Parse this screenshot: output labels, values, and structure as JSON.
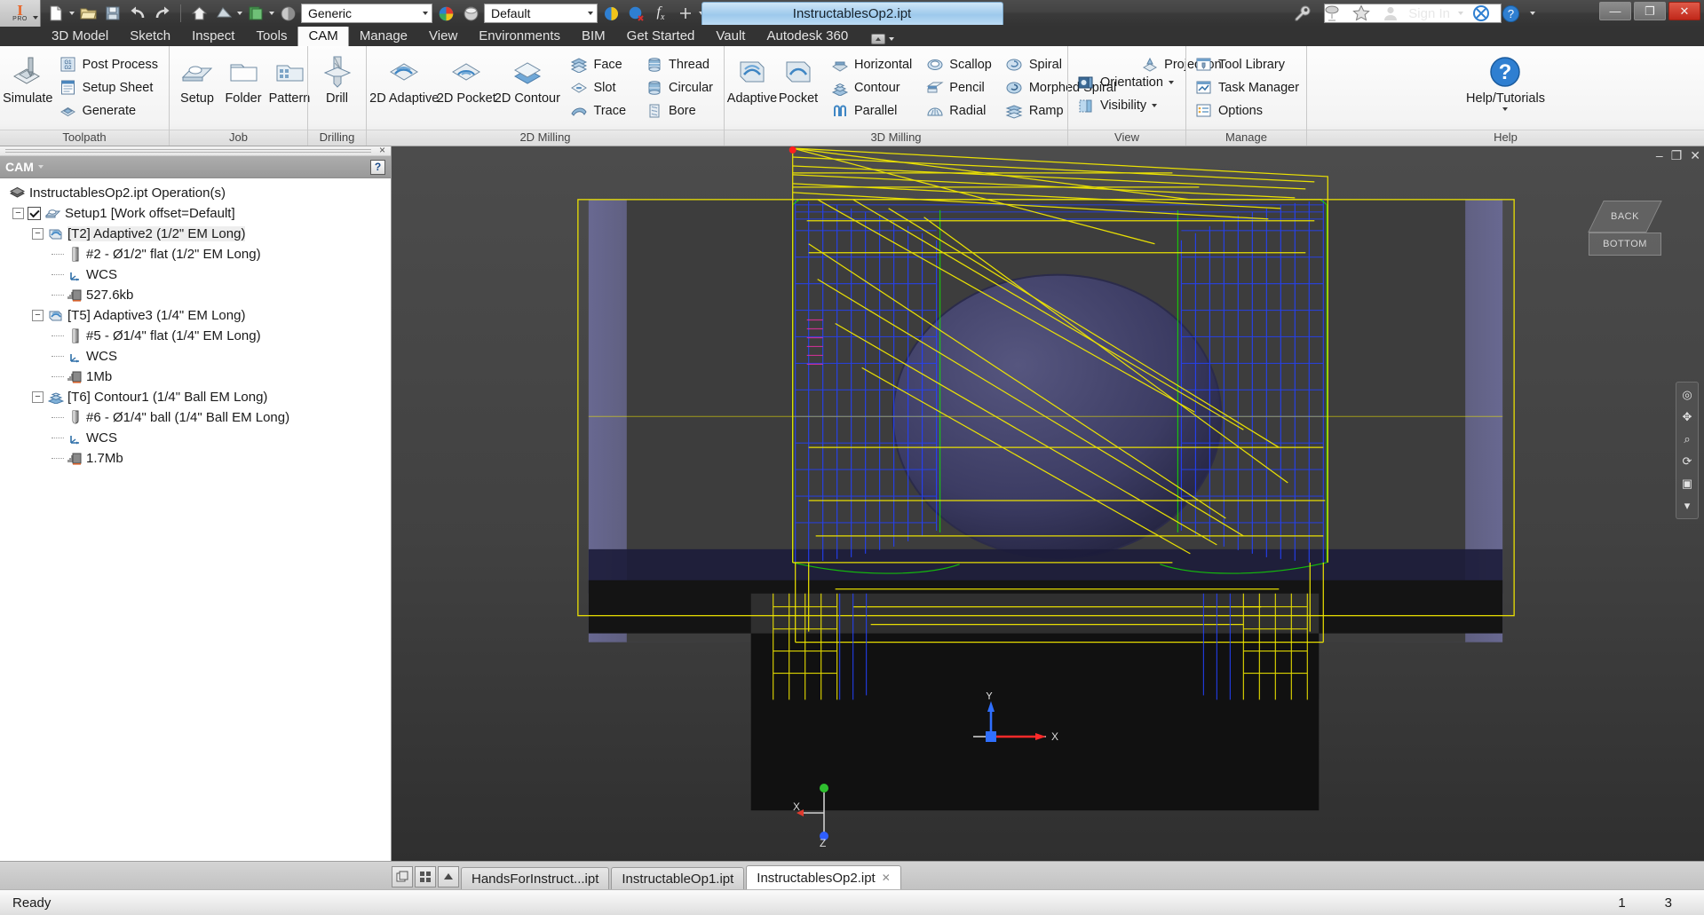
{
  "titlebar": {
    "app_name": "PRO",
    "document_title": "InstructablesOp2.ipt",
    "material_combo": "Generic",
    "appearance_combo": "Default",
    "search_placeholder": "",
    "search_value": "",
    "signin_label": "Sign In",
    "quick_access": [
      {
        "name": "new-file-icon",
        "label": "New"
      },
      {
        "name": "open-file-icon",
        "label": "Open"
      },
      {
        "name": "save-icon",
        "label": "Save"
      },
      {
        "name": "undo-icon",
        "label": "Undo"
      },
      {
        "name": "redo-icon",
        "label": "Redo"
      },
      {
        "name": "home-icon",
        "label": "Home"
      },
      {
        "name": "return-icon",
        "label": "Return"
      },
      {
        "name": "parameters-icon",
        "label": "Parameters"
      },
      {
        "name": "material-icon",
        "label": "Material"
      },
      {
        "name": "appearance-icon",
        "label": "Appearance"
      },
      {
        "name": "update-icon",
        "label": "Update"
      },
      {
        "name": "fx-icon",
        "label": "fx"
      },
      {
        "name": "plus-icon",
        "label": "Add"
      }
    ],
    "right_icons": [
      {
        "name": "wrench-icon",
        "label": "Help Options"
      },
      {
        "name": "satellite-icon",
        "label": "Autodesk 360"
      },
      {
        "name": "star-icon",
        "label": "Favorites"
      },
      {
        "name": "user-icon",
        "label": "Account"
      }
    ],
    "window_buttons": [
      {
        "name": "minimize-button",
        "glyph": "—"
      },
      {
        "name": "restore-button",
        "glyph": "❐"
      },
      {
        "name": "close-button",
        "glyph": "✕"
      }
    ]
  },
  "ribbon": {
    "tabs": [
      {
        "label": "3D Model",
        "active": false
      },
      {
        "label": "Sketch",
        "active": false
      },
      {
        "label": "Inspect",
        "active": false
      },
      {
        "label": "Tools",
        "active": false
      },
      {
        "label": "CAM",
        "active": true
      },
      {
        "label": "Manage",
        "active": false
      },
      {
        "label": "View",
        "active": false
      },
      {
        "label": "Environments",
        "active": false
      },
      {
        "label": "BIM",
        "active": false
      },
      {
        "label": "Get Started",
        "active": false
      },
      {
        "label": "Vault",
        "active": false
      },
      {
        "label": "Autodesk 360",
        "active": false
      }
    ],
    "panels": [
      {
        "title": "Toolpath",
        "big_buttons": [
          {
            "label": "Simulate",
            "icon": "simulate-icon"
          }
        ],
        "small_buttons": [
          {
            "label": "Post Process",
            "icon": "post-process-icon"
          },
          {
            "label": "Setup Sheet",
            "icon": "setup-sheet-icon"
          },
          {
            "label": "Generate",
            "icon": "generate-icon"
          }
        ]
      },
      {
        "title": "Job",
        "big_buttons": [
          {
            "label": "Setup",
            "icon": "setup-icon"
          },
          {
            "label": "Folder",
            "icon": "folder-icon"
          },
          {
            "label": "Pattern",
            "icon": "pattern-icon"
          }
        ],
        "small_buttons": []
      },
      {
        "title": "Drilling",
        "big_buttons": [
          {
            "label": "Drill",
            "icon": "drill-icon"
          }
        ],
        "small_buttons": []
      },
      {
        "title": "2D Milling",
        "big_buttons": [
          {
            "label": "2D Adaptive",
            "icon": "2d-adaptive-icon"
          },
          {
            "label": "2D Pocket",
            "icon": "2d-pocket-icon"
          },
          {
            "label": "2D Contour",
            "icon": "2d-contour-icon"
          }
        ],
        "small_col_a": [
          {
            "label": "Face",
            "icon": "face-icon"
          },
          {
            "label": "Slot",
            "icon": "slot-icon"
          },
          {
            "label": "Trace",
            "icon": "trace-icon"
          }
        ],
        "small_col_b": [
          {
            "label": "Thread",
            "icon": "thread-icon"
          },
          {
            "label": "Circular",
            "icon": "circular-icon"
          },
          {
            "label": "Bore",
            "icon": "bore-icon"
          }
        ]
      },
      {
        "title": "3D Milling",
        "big_buttons": [
          {
            "label": "Adaptive",
            "icon": "adaptive-icon"
          },
          {
            "label": "Pocket",
            "icon": "pocket-icon"
          }
        ],
        "small_col_a": [
          {
            "label": "Horizontal",
            "icon": "horizontal-icon"
          },
          {
            "label": "Contour",
            "icon": "contour-icon"
          },
          {
            "label": "Parallel",
            "icon": "parallel-icon"
          }
        ],
        "small_col_b": [
          {
            "label": "Scallop",
            "icon": "scallop-icon"
          },
          {
            "label": "Pencil",
            "icon": "pencil-icon"
          },
          {
            "label": "Radial",
            "icon": "radial-icon"
          }
        ],
        "small_col_c": [
          {
            "label": "Spiral",
            "icon": "spiral-icon"
          },
          {
            "label": "Morphed Spiral",
            "icon": "morphed-spiral-icon"
          },
          {
            "label": "Ramp",
            "icon": "ramp-icon"
          }
        ],
        "small_col_d": [
          {
            "label": "Projection",
            "icon": "projection-icon"
          }
        ]
      },
      {
        "title": "View",
        "small_buttons": [
          {
            "label": "Orientation",
            "icon": "orientation-icon",
            "dropdown": true
          },
          {
            "label": "Visibility",
            "icon": "visibility-icon",
            "dropdown": true
          }
        ]
      },
      {
        "title": "Manage",
        "small_buttons": [
          {
            "label": "Tool Library",
            "icon": "tool-library-icon"
          },
          {
            "label": "Task Manager",
            "icon": "task-manager-icon"
          },
          {
            "label": "Options",
            "icon": "options-icon"
          }
        ]
      },
      {
        "title": "Help",
        "big_buttons": [
          {
            "label": "Help/Tutorials",
            "icon": "help-icon"
          }
        ],
        "small_buttons": []
      }
    ]
  },
  "browser": {
    "header_label": "CAM",
    "help_glyph": "?",
    "tree": [
      {
        "level": 0,
        "label": "InstructablesOp2.ipt Operation(s)",
        "icon": "document-icon",
        "expander": null,
        "checkbox": false,
        "selected": false
      },
      {
        "level": 1,
        "label": "Setup1 [Work offset=Default]",
        "icon": "setup-icon",
        "expander": "minus",
        "checkbox": true,
        "selected": false
      },
      {
        "level": 2,
        "label": "[T2] Adaptive2 (1/2\" EM Long)",
        "icon": "adaptive-op-icon",
        "expander": "minus",
        "checkbox": false,
        "selected": true
      },
      {
        "level": 3,
        "label": "#2 - Ø1/2\" flat (1/2\" EM Long)",
        "icon": "flat-tool-icon",
        "expander": null,
        "checkbox": false,
        "selected": false
      },
      {
        "level": 3,
        "label": "WCS",
        "icon": "wcs-icon",
        "expander": null,
        "checkbox": false,
        "selected": false
      },
      {
        "level": 3,
        "label": "527.6kb",
        "icon": "toolpath-data-icon",
        "expander": null,
        "checkbox": false,
        "selected": false
      },
      {
        "level": 2,
        "label": "[T5] Adaptive3 (1/4\" EM Long)",
        "icon": "adaptive-op-icon",
        "expander": "minus",
        "checkbox": false,
        "selected": false
      },
      {
        "level": 3,
        "label": "#5 - Ø1/4\" flat (1/4\" EM Long)",
        "icon": "flat-tool-icon",
        "expander": null,
        "checkbox": false,
        "selected": false
      },
      {
        "level": 3,
        "label": "WCS",
        "icon": "wcs-icon",
        "expander": null,
        "checkbox": false,
        "selected": false
      },
      {
        "level": 3,
        "label": "1Mb",
        "icon": "toolpath-data-icon",
        "expander": null,
        "checkbox": false,
        "selected": false
      },
      {
        "level": 2,
        "label": "[T6] Contour1 (1/4\" Ball EM Long)",
        "icon": "contour-op-icon",
        "expander": "minus",
        "checkbox": false,
        "selected": false
      },
      {
        "level": 3,
        "label": "#6 - Ø1/4\" ball (1/4\" Ball EM Long)",
        "icon": "ball-tool-icon",
        "expander": null,
        "checkbox": false,
        "selected": false
      },
      {
        "level": 3,
        "label": "WCS",
        "icon": "wcs-icon",
        "expander": null,
        "checkbox": false,
        "selected": false
      },
      {
        "level": 3,
        "label": "1.7Mb",
        "icon": "toolpath-data-icon",
        "expander": null,
        "checkbox": false,
        "selected": false
      }
    ]
  },
  "viewport": {
    "navcube": {
      "back_label": "BACK",
      "bottom_label": "BOTTOM"
    },
    "axis_labels": {
      "x": "X",
      "y": "Y",
      "z": "Z"
    },
    "wcs_axis_labels": {
      "x": "X",
      "y": "Y"
    },
    "window_controls": [
      {
        "name": "vp-minimize-button",
        "glyph": "–"
      },
      {
        "name": "vp-restore-button",
        "glyph": "❐"
      },
      {
        "name": "vp-close-button",
        "glyph": "✕"
      }
    ],
    "nav_tools": [
      "◉",
      "☝",
      "⊕",
      "⛶",
      "⊟",
      "▭"
    ],
    "colors": {
      "toolpath_rapid": "#ffff00",
      "toolpath_cut": "#1a3cff",
      "toolpath_lead": "#00c000",
      "stock_body": "#5a5a82",
      "part_body": "#3a3a3a"
    }
  },
  "doctabs": {
    "controls": [
      {
        "name": "tile-windows-button",
        "glyph": "❐"
      },
      {
        "name": "arrange-windows-button",
        "glyph": "▒"
      },
      {
        "name": "scroll-tabs-button",
        "glyph": "▲"
      }
    ],
    "tabs": [
      {
        "label": "HandsForInstruct...ipt",
        "active": false,
        "closable": false
      },
      {
        "label": "InstructableOp1.ipt",
        "active": false,
        "closable": false
      },
      {
        "label": "InstructablesOp2.ipt",
        "active": true,
        "closable": true
      }
    ]
  },
  "statusbar": {
    "message": "Ready",
    "right_values": [
      "1",
      "3"
    ]
  }
}
